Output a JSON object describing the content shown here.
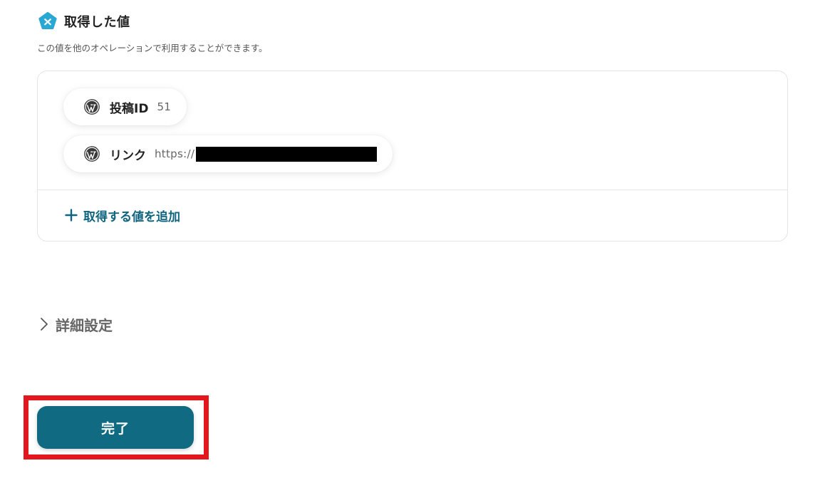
{
  "section": {
    "title": "取得した値",
    "description": "この値を他のオペレーションで利用することができます。",
    "logo_icon": "yoom-logo-icon",
    "accent_color": "#2aa8d4"
  },
  "values": [
    {
      "icon": "wordpress-icon",
      "label": "投稿ID",
      "value": "51"
    },
    {
      "icon": "wordpress-icon",
      "label": "リンク",
      "value": "https://",
      "redacted": true
    }
  ],
  "add_value": {
    "icon": "plus-icon",
    "label": "取得する値を追加"
  },
  "advanced_settings": {
    "icon": "chevron-right-icon",
    "label": "詳細設定"
  },
  "done_button": {
    "label": "完了",
    "color": "#0f6a82",
    "highlight_color": "#e3171e"
  }
}
